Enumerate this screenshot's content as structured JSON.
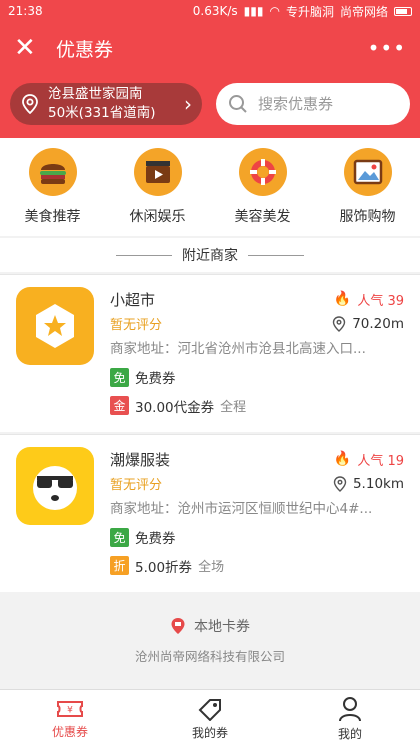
{
  "status": {
    "time": "21:38",
    "speed": "0.63K/s",
    "wifi_name": "专升脑洞",
    "carrier": "尚帝网络"
  },
  "nav": {
    "title": "优惠券",
    "more": "•••"
  },
  "location": {
    "line1": "沧县盛世家园南",
    "line2": "50米(331省道南)"
  },
  "search": {
    "placeholder": "搜索优惠券"
  },
  "categories": [
    {
      "label": "美食推荐",
      "icon": "burger-icon"
    },
    {
      "label": "休闲娱乐",
      "icon": "film-clapper-icon"
    },
    {
      "label": "美容美发",
      "icon": "lifebuoy-icon"
    },
    {
      "label": "服饰购物",
      "icon": "picture-icon"
    }
  ],
  "section_title": "附近商家",
  "merchants": [
    {
      "name": "小超市",
      "popularity": "人气 39",
      "rating": "暂无评分",
      "distance": "70.20m",
      "address": "商家地址：河北省沧州市沧县北高速入口...",
      "coupons": [
        {
          "tag": "免",
          "text": "免费券",
          "sub": ""
        },
        {
          "tag": "金",
          "text": "30.00代金券",
          "sub": "全程"
        }
      ]
    },
    {
      "name": "潮爆服装",
      "popularity": "人气 19",
      "rating": "暂无评分",
      "distance": "5.10km",
      "address": "商家地址：沧州市运河区恒顺世纪中心4#...",
      "coupons": [
        {
          "tag": "免",
          "text": "免费券",
          "sub": ""
        },
        {
          "tag": "折",
          "text": "5.00折券",
          "sub": "全场"
        }
      ]
    }
  ],
  "footer": {
    "brand": "本地卡券",
    "company": "沧州尚帝网络科技有限公司"
  },
  "tabs": [
    {
      "label": "优惠券",
      "active": true
    },
    {
      "label": "我的券",
      "active": false
    },
    {
      "label": "我的",
      "active": false
    }
  ],
  "colors": {
    "primary": "#f0474b",
    "accent_orange": "#f4a428",
    "green": "#3ba845"
  }
}
